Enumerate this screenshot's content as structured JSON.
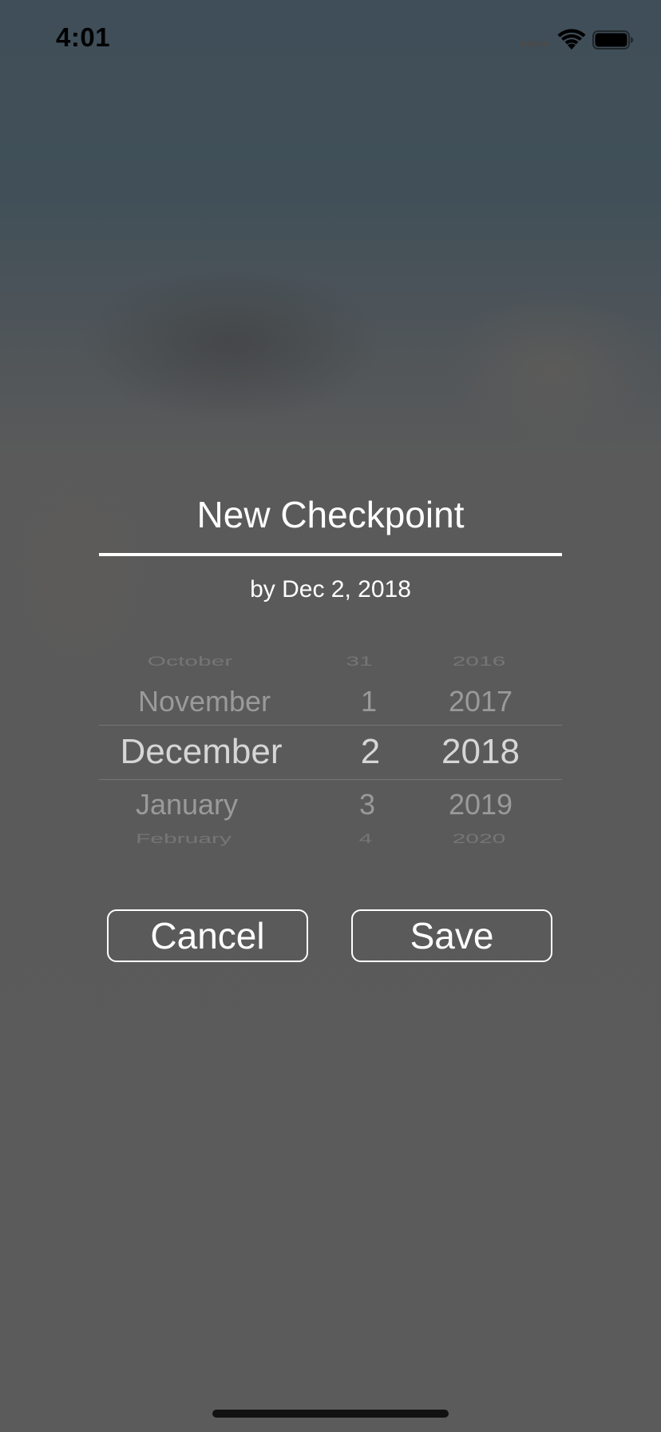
{
  "status_bar": {
    "time": "4:01",
    "icons": [
      "cellular-signal-icon",
      "wifi-icon",
      "battery-icon"
    ]
  },
  "dialog": {
    "title": "New Checkpoint",
    "subtitle": "by Dec 2, 2018"
  },
  "date_picker": {
    "months": [
      "October",
      "November",
      "December",
      "January",
      "February"
    ],
    "days": [
      "31",
      "1",
      "2",
      "3",
      "4"
    ],
    "years": [
      "2016",
      "2017",
      "2018",
      "2019",
      "2020"
    ],
    "selected": {
      "month": "December",
      "day": "2",
      "year": "2018"
    }
  },
  "buttons": {
    "cancel_label": "Cancel",
    "save_label": "Save"
  },
  "colors": {
    "background": "#5b5b5b",
    "text": "#ffffff",
    "picker_selected": "#d6d6d6",
    "picker_unselected": "#9a9a9a"
  }
}
